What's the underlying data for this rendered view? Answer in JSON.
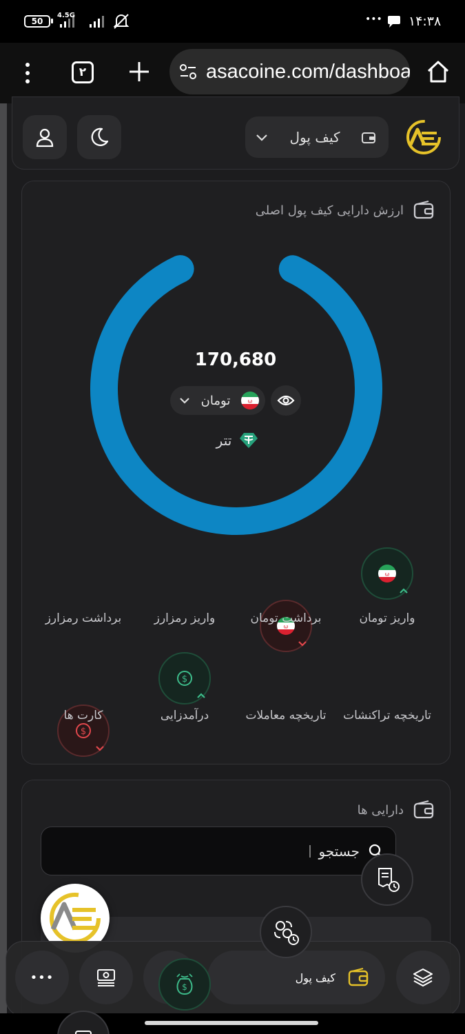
{
  "status_bar": {
    "battery": "50",
    "network": "4.5G",
    "time": "۱۴:۳۸",
    "more_dots": "•••"
  },
  "browser": {
    "tab_count": "۲",
    "url": "asacoine.com/dashboard"
  },
  "header": {
    "wallet_selector_label": "کیف پول"
  },
  "main_wallet": {
    "title": "ارزش دارایی کیف پول اصلی",
    "balance": "170,680",
    "currency": "تومان",
    "legend_item": "تتر",
    "ring_color": "#0d86c4",
    "ring_fraction": 0.86
  },
  "actions": [
    {
      "label": "واریز تومان",
      "icon": "iran-flag-icon",
      "direction": "up"
    },
    {
      "label": "برداشت تومان",
      "icon": "iran-flag-icon",
      "direction": "down"
    },
    {
      "label": "واریز رمزارز",
      "icon": "dollar-coin-icon",
      "direction": "up"
    },
    {
      "label": "برداشت رمزارز",
      "icon": "dollar-coin-icon",
      "direction": "down"
    },
    {
      "label": "تاریخچه تراکنشات",
      "icon": "receipt-history-icon"
    },
    {
      "label": "تاریخچه معاملات",
      "icon": "exchange-history-icon"
    },
    {
      "label": "درآمدزایی",
      "icon": "money-bag-icon"
    },
    {
      "label": "کارت ها",
      "icon": "card-icon"
    }
  ],
  "assets": {
    "title": "دارایی ها",
    "search_placeholder": "جستجو"
  },
  "bottom_nav": {
    "wallet_label": "کیف پول",
    "more": "•••"
  },
  "colors": {
    "green": "#3dbb8a",
    "red": "#e0474c",
    "gold": "#e6c229"
  }
}
